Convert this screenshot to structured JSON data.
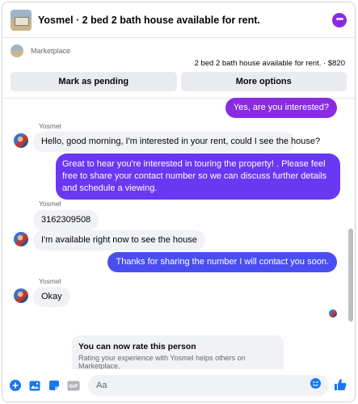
{
  "header": {
    "title": "Yosmel · 2 bed 2 bath house available for rent.",
    "more_icon": "more-dots-icon",
    "accent": "#8a2be2"
  },
  "marketplace": {
    "label": "Marketplace",
    "listing": "2 bed 2 bath house available for rent. · $820",
    "pending_label": "Mark as pending",
    "more_options_label": "More options"
  },
  "messages": [
    {
      "from": "me",
      "text": "Yes, are you interested?"
    },
    {
      "from": "them",
      "sender": "Yosmel",
      "text": "Hello, good morning, I'm interested in your rent, could I see the house?"
    },
    {
      "from": "me",
      "text": "Great to hear you're interested in touring the property! . Please feel free to share your contact number so we can discuss further details and schedule a viewing."
    },
    {
      "from": "them",
      "sender": "Yosmel",
      "text": "3162309508"
    },
    {
      "from": "them",
      "text": "I'm available right now to see the house"
    },
    {
      "from": "me",
      "text": "Thanks for sharing the number I will contact you soon."
    },
    {
      "from": "them",
      "sender": "Yosmel",
      "text": "Okay"
    }
  ],
  "rate": {
    "title": "You can now rate this person",
    "subtitle": "Rating your experience with Yosmel helps others on Marketplace."
  },
  "composer": {
    "placeholder": "Aa",
    "icons": [
      "plus-circle-icon",
      "photo-icon",
      "sticker-icon",
      "gif-icon",
      "emoji-icon",
      "thumbs-up-icon"
    ]
  },
  "colors": {
    "bubble_purple": "#8a2be2",
    "bubble_violet": "#6a37f2",
    "bubble_blue": "#4a4ef0",
    "icon_blue": "#1877f2"
  }
}
